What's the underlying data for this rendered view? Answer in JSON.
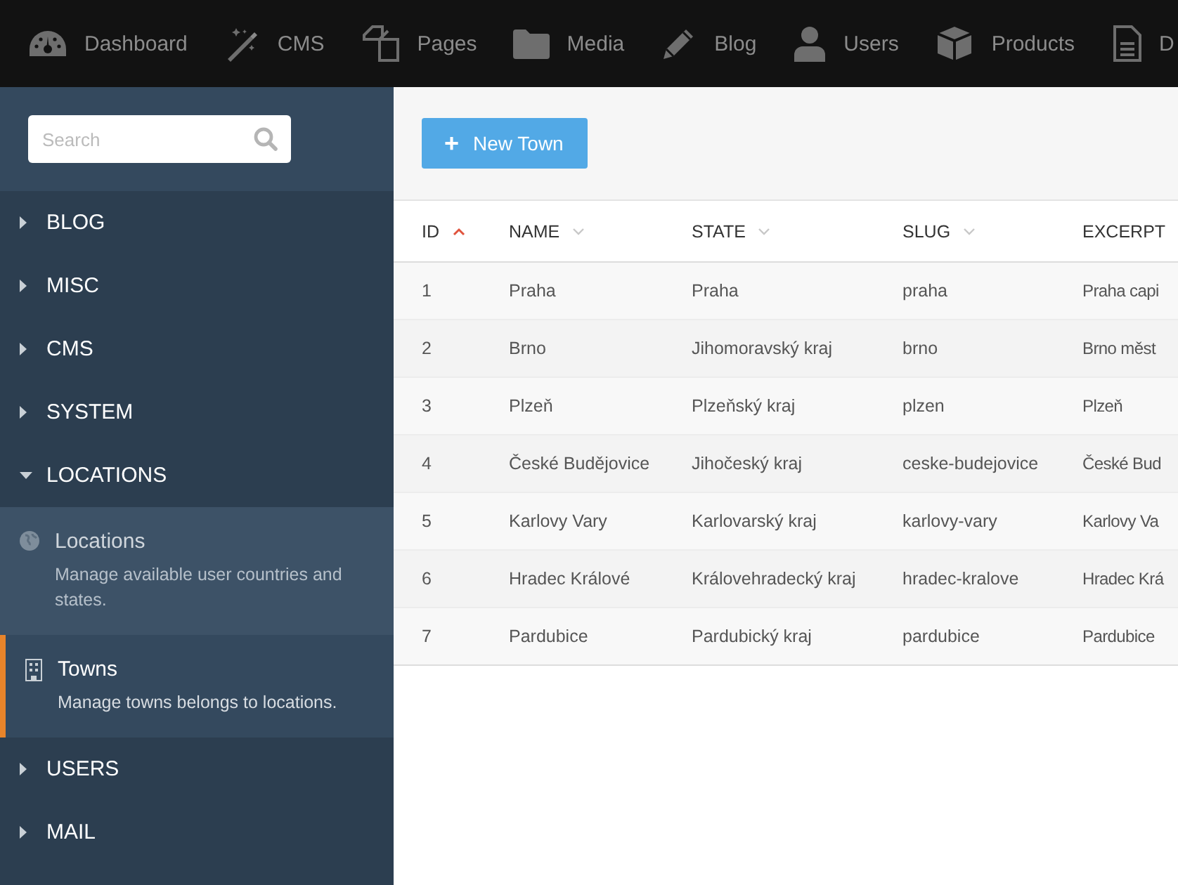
{
  "top_nav": [
    {
      "label": "Dashboard"
    },
    {
      "label": "CMS"
    },
    {
      "label": "Pages"
    },
    {
      "label": "Media"
    },
    {
      "label": "Blog"
    },
    {
      "label": "Users"
    },
    {
      "label": "Products"
    },
    {
      "label": "D"
    }
  ],
  "sidebar": {
    "search": {
      "placeholder": "Search"
    },
    "groups": [
      {
        "label": "BLOG",
        "expanded": false
      },
      {
        "label": "MISC",
        "expanded": false
      },
      {
        "label": "CMS",
        "expanded": false
      },
      {
        "label": "SYSTEM",
        "expanded": false
      },
      {
        "label": "LOCATIONS",
        "expanded": true,
        "children": [
          {
            "title": "Locations",
            "description": "Manage available user countries and states.",
            "selected": false
          },
          {
            "title": "Towns",
            "description": "Manage towns belongs to locations.",
            "selected": true
          }
        ]
      },
      {
        "label": "USERS",
        "expanded": false
      },
      {
        "label": "MAIL",
        "expanded": false
      }
    ]
  },
  "toolbar": {
    "button": {
      "icon": "+",
      "label": "New Town"
    }
  },
  "table": {
    "columns": [
      {
        "label": "ID",
        "sorted": true
      },
      {
        "label": "NAME",
        "sorted": false
      },
      {
        "label": "STATE",
        "sorted": false
      },
      {
        "label": "SLUG",
        "sorted": false
      },
      {
        "label": "EXCERPT"
      }
    ],
    "rows": [
      [
        "1",
        "Praha",
        "Praha",
        "praha",
        "Praha capi"
      ],
      [
        "2",
        "Brno",
        "Jihomoravský kraj",
        "brno",
        "Brno měst"
      ],
      [
        "3",
        "Plzeň",
        "Plzeňský kraj",
        "plzen",
        "Plzeň"
      ],
      [
        "4",
        "České Budějovice",
        "Jihočeský kraj",
        "ceske-budejovice",
        "České Bud"
      ],
      [
        "5",
        "Karlovy Vary",
        "Karlovarský kraj",
        "karlovy-vary",
        "Karlovy Va"
      ],
      [
        "6",
        "Hradec Králové",
        "Královehradecký kraj",
        "hradec-kralove",
        "Hradec Krá"
      ],
      [
        "7",
        "Pardubice",
        "Pardubický kraj",
        "pardubice",
        "Pardubice"
      ]
    ]
  }
}
